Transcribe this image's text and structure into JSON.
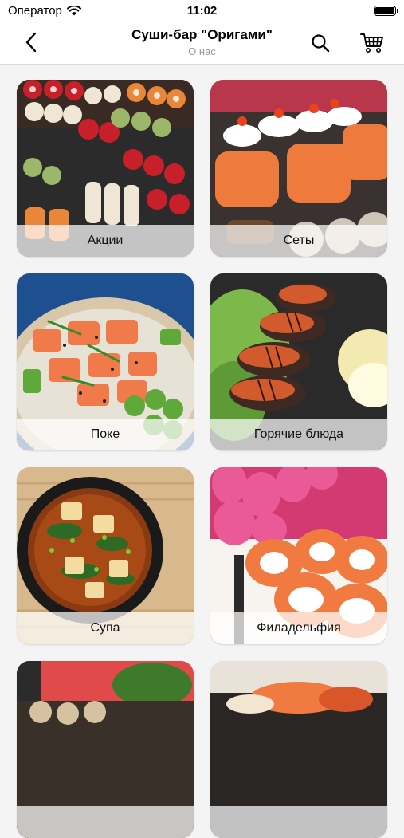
{
  "status": {
    "carrier": "Оператор",
    "time": "11:02"
  },
  "header": {
    "title": "Суши-бар \"Оригами\"",
    "subtitle": "О нас"
  },
  "icons": {
    "back": "chevron-left-icon",
    "search": "search-icon",
    "cart": "cart-icon"
  },
  "categories": [
    {
      "label": "Акции"
    },
    {
      "label": "Сеты"
    },
    {
      "label": "Поке"
    },
    {
      "label": "Горячие блюда"
    },
    {
      "label": "Супа"
    },
    {
      "label": "Филадельфия"
    },
    {
      "label": ""
    },
    {
      "label": ""
    }
  ]
}
